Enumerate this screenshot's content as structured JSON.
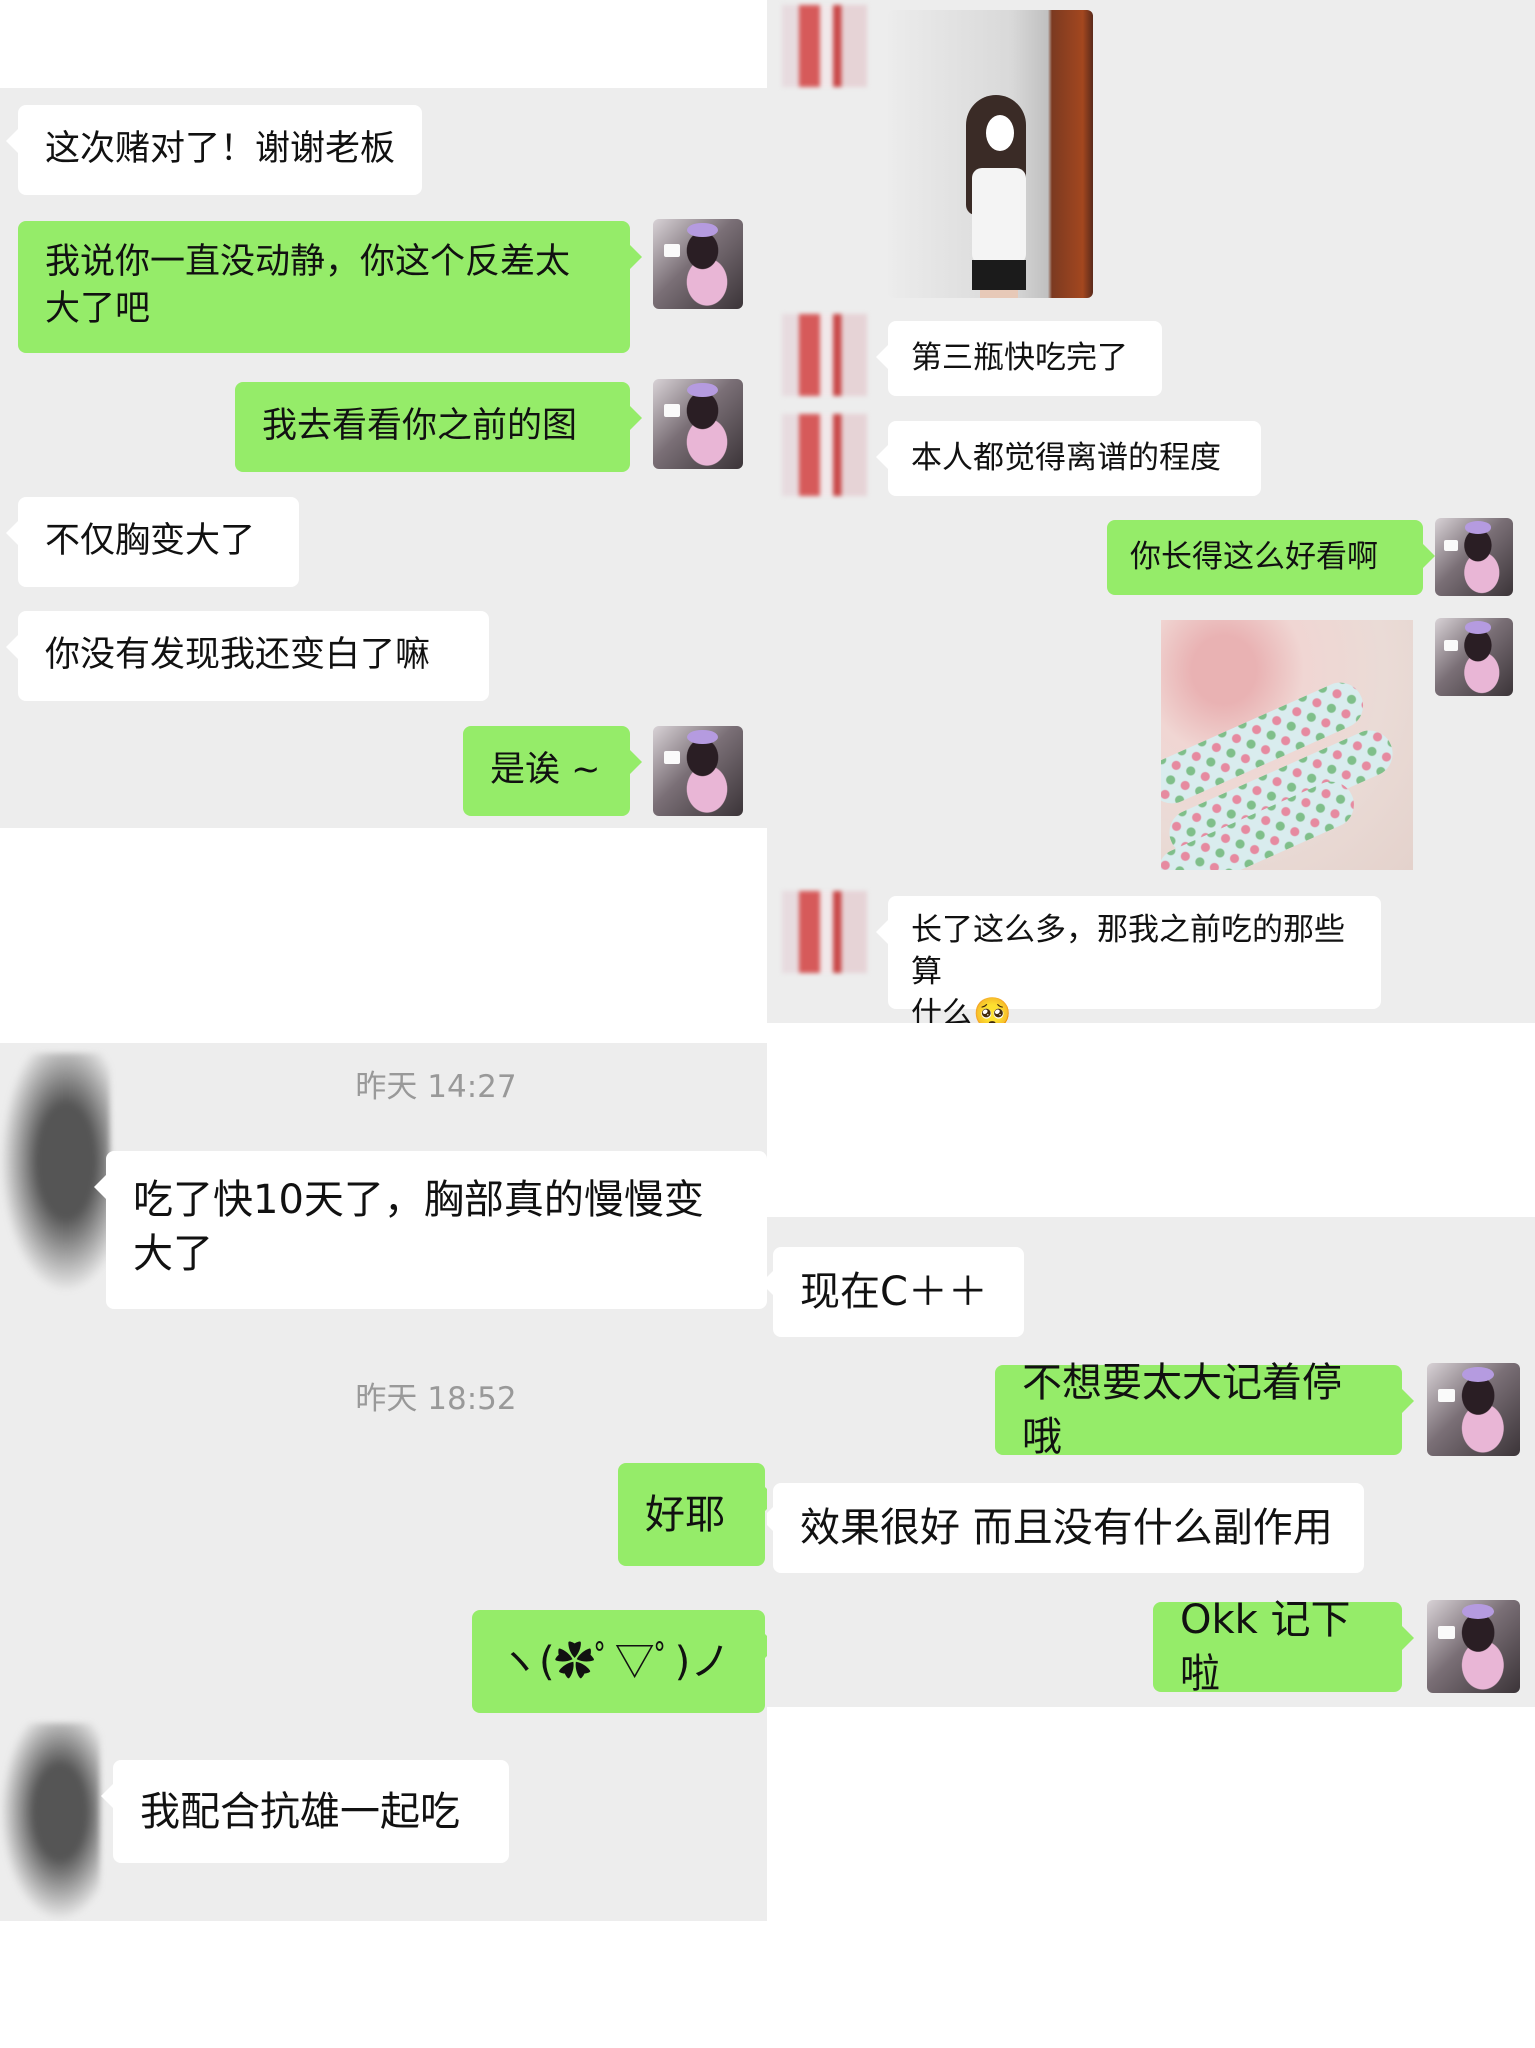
{
  "left_top": {
    "messages": [
      {
        "dir": "in",
        "text": "这次赌对了！谢谢老板"
      },
      {
        "dir": "out",
        "lines": [
          "我说你一直没动静，你这个反差太",
          "大了吧"
        ]
      },
      {
        "dir": "out",
        "text": "我去看看你之前的图"
      },
      {
        "dir": "in",
        "text": "不仅胸变大了"
      },
      {
        "dir": "in",
        "text": "你没有发现我还变白了嘛"
      },
      {
        "dir": "out",
        "text": "是诶 ~"
      }
    ]
  },
  "right_top": {
    "messages": [
      {
        "dir": "in",
        "type": "image",
        "content": "photo"
      },
      {
        "dir": "in",
        "text": "第三瓶快吃完了"
      },
      {
        "dir": "in",
        "text": "本人都觉得离谱的程度"
      },
      {
        "dir": "out",
        "text": "你长得这么好看啊"
      },
      {
        "dir": "out",
        "type": "image",
        "content": "photo"
      },
      {
        "dir": "in",
        "lines": [
          "长了这么多，那我之前吃的那些算",
          "什么🥺"
        ]
      }
    ]
  },
  "left_bottom": {
    "timestamps": [
      "昨天 14:27",
      "昨天 18:52"
    ],
    "messages": [
      {
        "dir": "in",
        "lines": [
          "吃了快10天了，胸部真的慢慢变",
          "大了"
        ]
      },
      {
        "dir": "out",
        "text": "好耶"
      },
      {
        "dir": "out",
        "text": "ヽ(✿ﾟ▽ﾟ)ノ"
      },
      {
        "dir": "in",
        "text": "我配合抗雄一起吃"
      }
    ]
  },
  "right_bottom": {
    "messages": [
      {
        "dir": "in",
        "text": "现在C＋＋"
      },
      {
        "dir": "out",
        "text": "不想要太大记着停哦"
      },
      {
        "dir": "in",
        "text": "效果很好  而且没有什么副作用"
      },
      {
        "dir": "out",
        "text": "Okk 记下啦"
      }
    ]
  },
  "colors": {
    "panel_bg": "#ededed",
    "bubble_out": "#95ec69",
    "bubble_in": "#ffffff",
    "timestamp": "#999999"
  }
}
